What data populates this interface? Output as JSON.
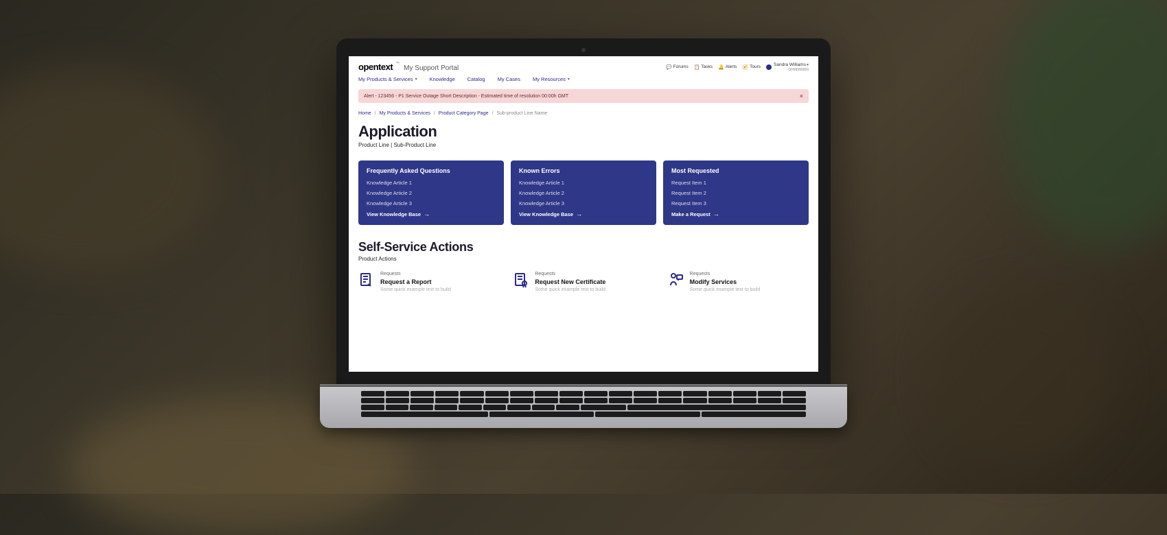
{
  "brand": {
    "logo": "opentext",
    "tm": "™",
    "sub": "My Support Portal"
  },
  "top_links": {
    "forums": "Forums",
    "tasks": "Tasks",
    "alerts": "Alerts",
    "tours": "Tours"
  },
  "user": {
    "name": "Sandra Williams",
    "id": "GH99999999"
  },
  "nav": {
    "products": "My Products & Services",
    "knowledge": "Knowledge",
    "catalog": "Catalog",
    "cases": "My Cases",
    "resources": "My Resources"
  },
  "alert": {
    "text": "Alert - 123456 - P1 Service Outage Short Description - Estimated time of resolution 00:00h GMT"
  },
  "crumbs": {
    "home": "Home",
    "products": "My Products & Services",
    "category": "Product Category Page",
    "current": "Sub-product Line Name"
  },
  "page": {
    "title": "Application",
    "subtitle": "Product Line | Sub-Product Line"
  },
  "cards": [
    {
      "title": "Frequently Asked Questions",
      "items": [
        "Knowledge Article 1",
        "Knowledge Article 2",
        "Knowledge Article 3"
      ],
      "cta": "View Knowledge Base"
    },
    {
      "title": "Known Errors",
      "items": [
        "Knowledge Article 1",
        "Knowledge Article 2",
        "Knowledge Article 3"
      ],
      "cta": "View Knowledge Base"
    },
    {
      "title": "Most Requested",
      "items": [
        "Request Item 1",
        "Request Item 2",
        "Request Item 3"
      ],
      "cta": "Make a Request"
    }
  ],
  "self_service": {
    "title": "Self-Service Actions",
    "subtitle": "Product Actions"
  },
  "actions": [
    {
      "category": "Requests",
      "title": "Request a Report",
      "desc": "Some quick example text to build"
    },
    {
      "category": "Requests",
      "title": "Request New Certificate",
      "desc": "Some quick example text to build"
    },
    {
      "category": "Requests",
      "title": "Modify Services",
      "desc": "Some quick example text to build"
    }
  ]
}
